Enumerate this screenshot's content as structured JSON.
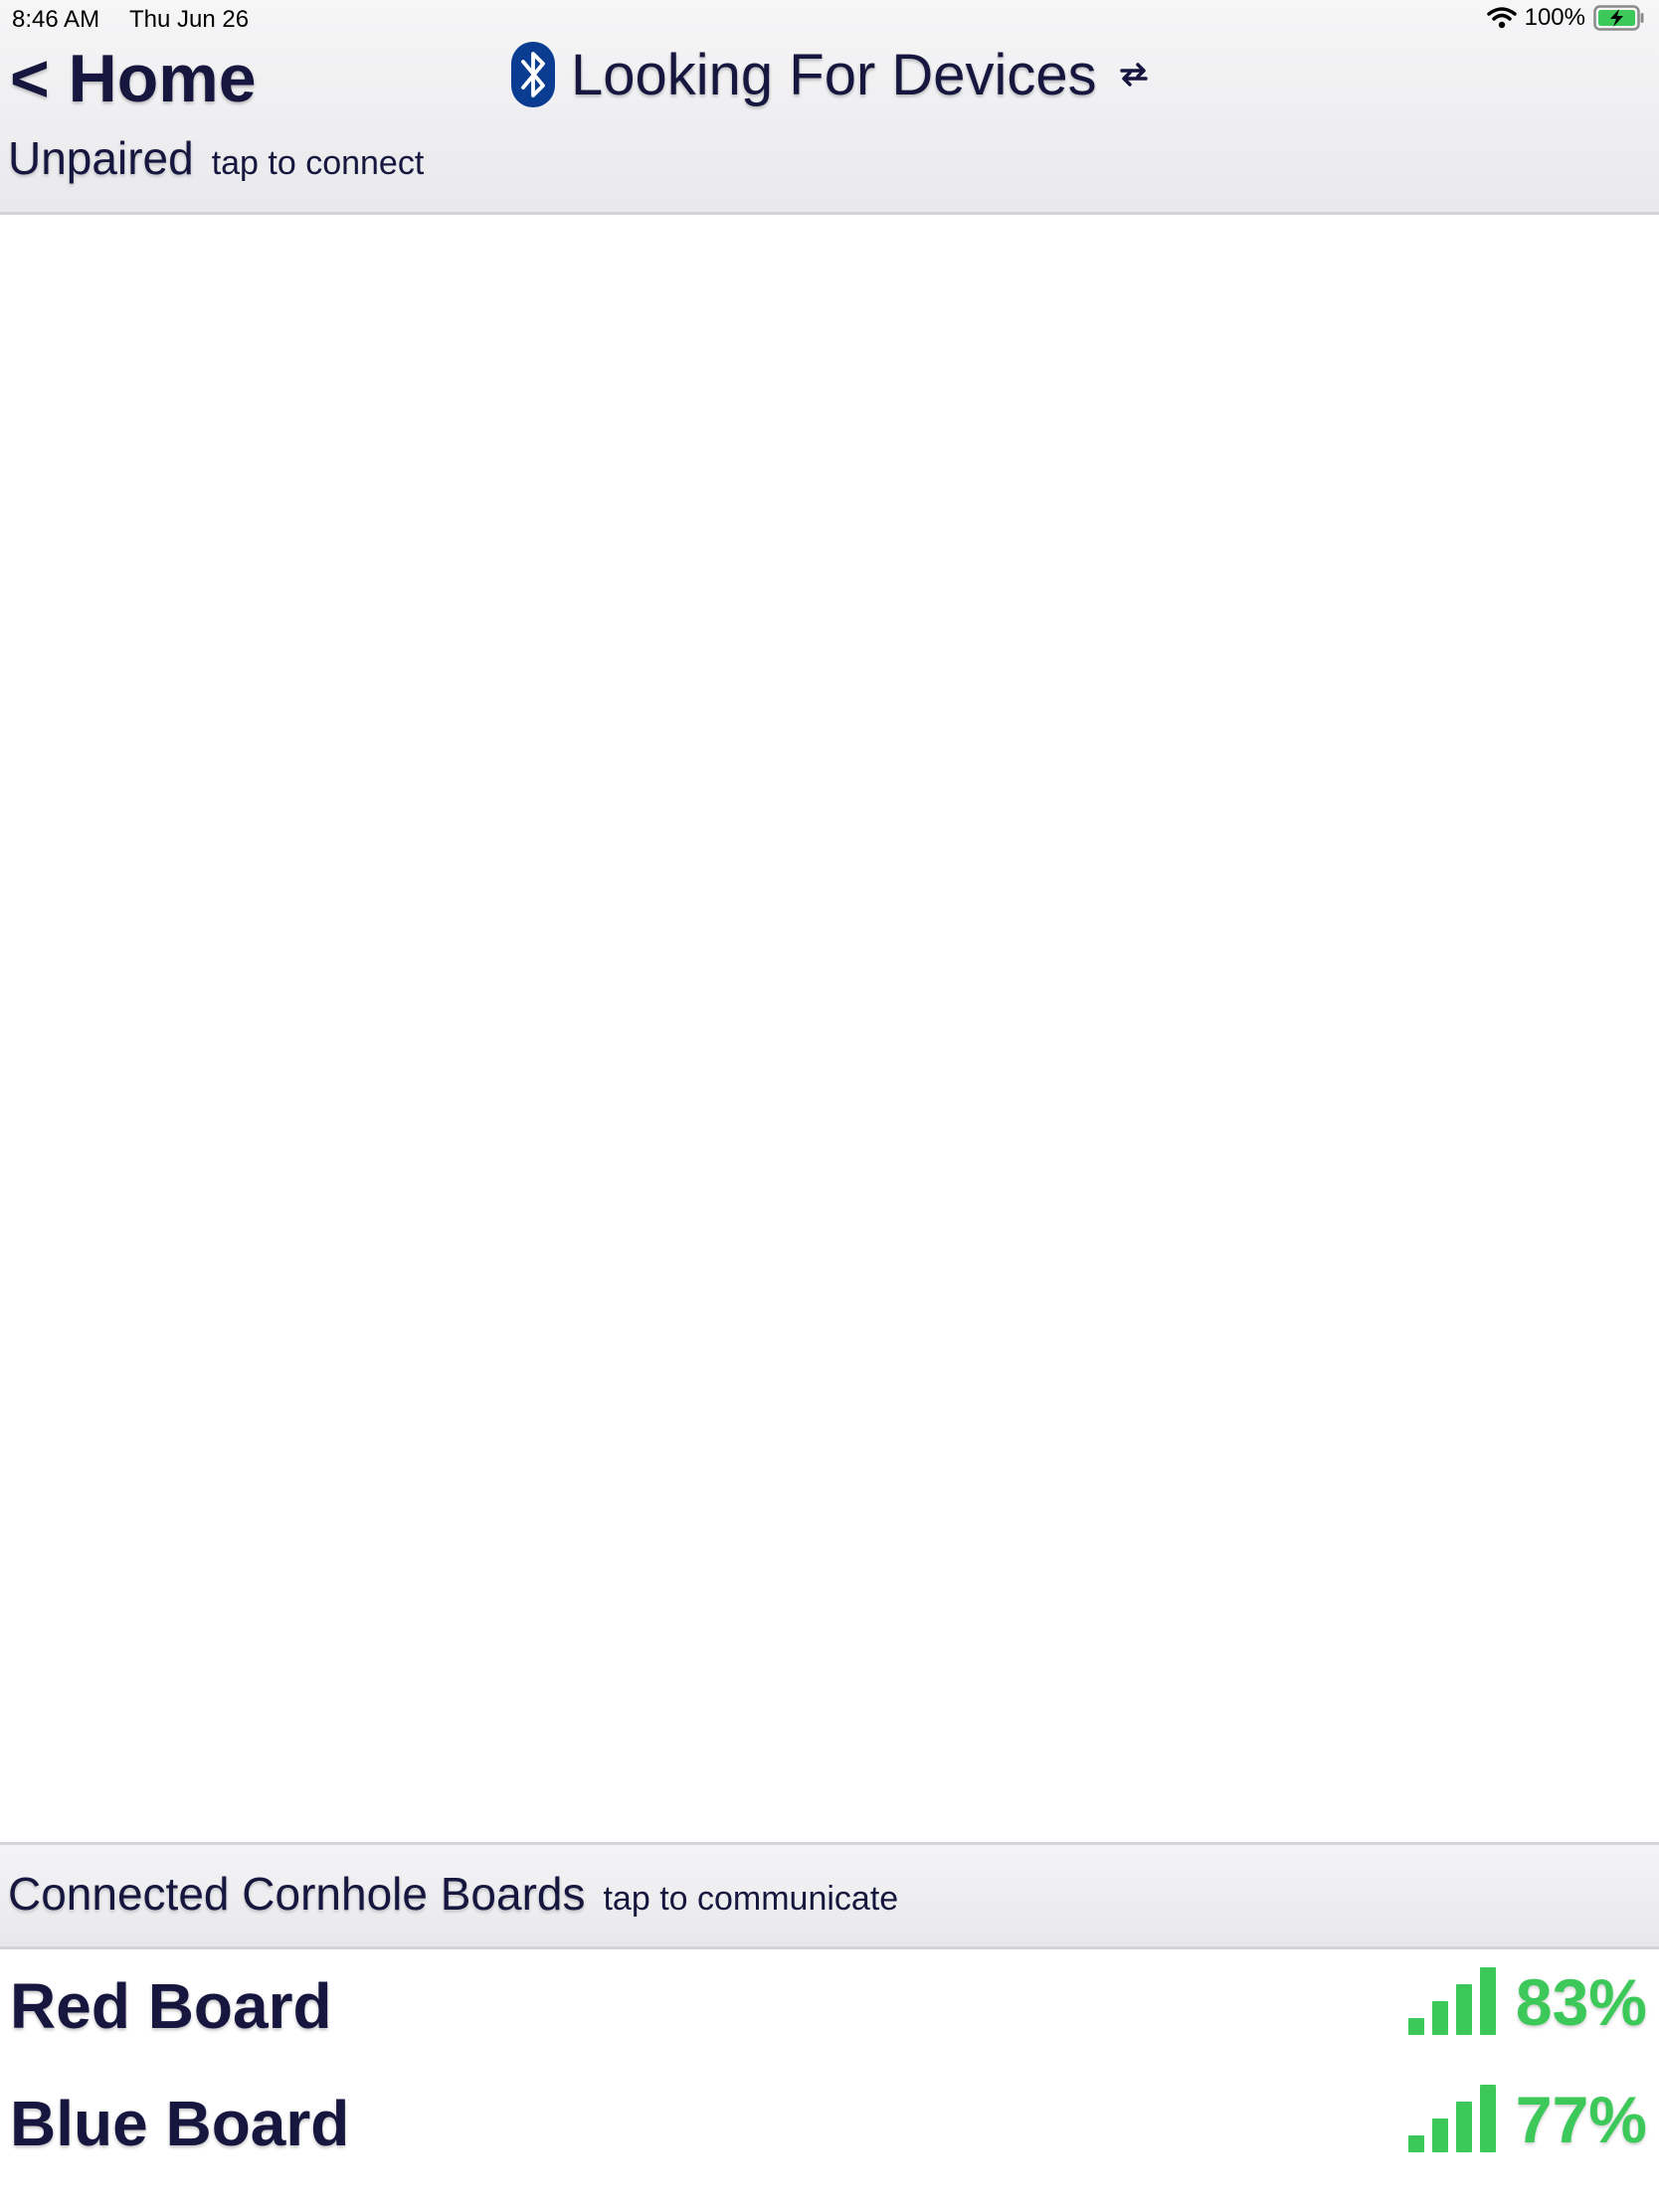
{
  "status_bar": {
    "time": "8:46 AM",
    "date": "Thu Jun 26",
    "battery": "100%",
    "wifi_icon": "wifi-icon",
    "battery_icon": "battery-charging-icon"
  },
  "header": {
    "back_label": "< Home",
    "title": "Looking For Devices",
    "bluetooth_icon": "bluetooth-icon",
    "refresh_icon": "refresh-icon"
  },
  "unpaired": {
    "title": "Unpaired",
    "hint": "tap to connect",
    "items": []
  },
  "connected": {
    "title": "Connected Cornhole Boards",
    "hint": "tap to communicate",
    "boards": [
      {
        "name": "Red Board",
        "signal": "83%",
        "signal_fraction": 0.83
      },
      {
        "name": "Blue Board",
        "signal": "77%",
        "signal_fraction": 0.77
      }
    ]
  },
  "colors": {
    "text": "#17163f",
    "signal": "#3cc95a",
    "bluetooth": "#0a3d91",
    "battery": "#3cc95a"
  }
}
